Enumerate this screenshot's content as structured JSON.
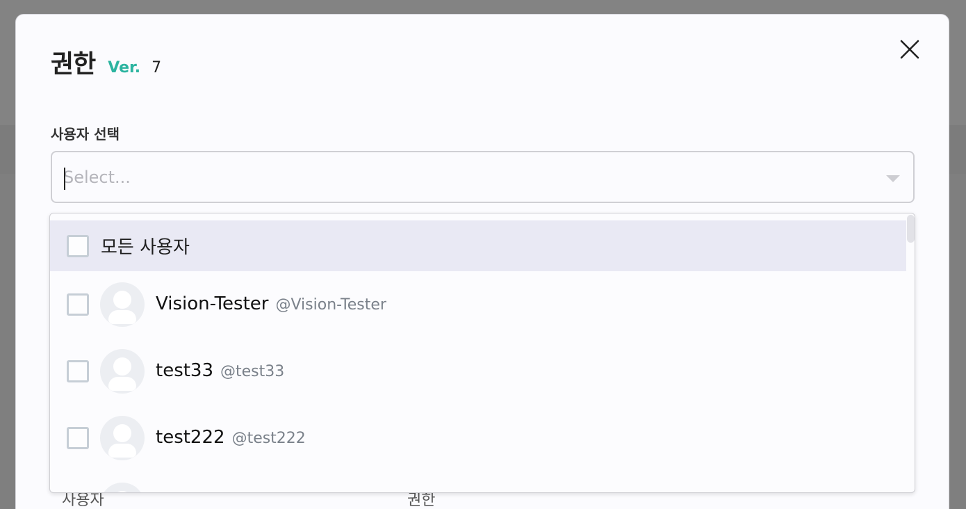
{
  "modal": {
    "title": "권한",
    "version_label": "Ver.",
    "version_number": "7",
    "close_icon": "close-icon"
  },
  "user_select": {
    "label": "사용자 선택",
    "placeholder": "Select...",
    "value": ""
  },
  "menu": {
    "all_users_label": "모든 사용자",
    "options": [
      {
        "name": "Vision-Tester",
        "handle": "@Vision-Tester"
      },
      {
        "name": "test33",
        "handle": "@test33"
      },
      {
        "name": "test222",
        "handle": "@test222"
      }
    ]
  },
  "background_table": {
    "col_user": "사용자",
    "col_permission": "권한"
  },
  "colors": {
    "accent": "#2cb4a0",
    "highlight_row": "#e9e9f4"
  }
}
